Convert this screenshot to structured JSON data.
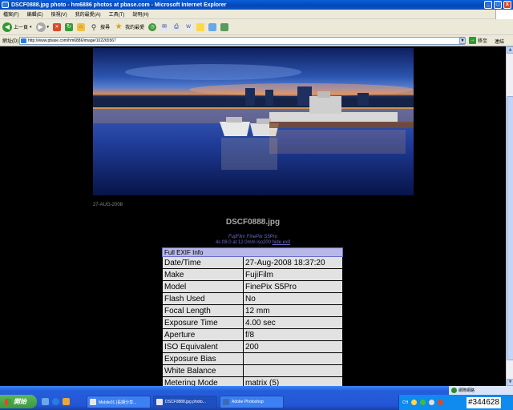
{
  "window": {
    "title": "DSCF0888.jpg photo - hm6886 photos at pbase.com - Microsoft Internet Explorer",
    "minimize": "_",
    "maximize": "□",
    "close": "x"
  },
  "menu": [
    "檔案(F)",
    "編輯(E)",
    "檢視(V)",
    "我的最愛(A)",
    "工具(T)",
    "說明(H)"
  ],
  "toolbar": {
    "back": "上一頁",
    "search": "搜尋",
    "favorites": "我的最愛"
  },
  "address": {
    "label": "網址(D)",
    "url": "http://www.pbase.com/hm6886/image/102265567",
    "go": "移至",
    "links": "連結"
  },
  "photo_page": {
    "date": "27-AUG-2008",
    "filename": "DSCF0888.jpg",
    "camera": "FujiFilm FinePix S5Pro",
    "settings": "4s f/8.0 at 12.0mm iso200",
    "hide_exif": "hide exif"
  },
  "exif": {
    "header": "Full EXIF Info",
    "rows": [
      [
        "Date/Time",
        "27-Aug-2008 18:37:20"
      ],
      [
        "Make",
        "FujiFilm"
      ],
      [
        "Model",
        "FinePix S5Pro"
      ],
      [
        "Flash Used",
        "No"
      ],
      [
        "Focal Length",
        "12 mm"
      ],
      [
        "Exposure Time",
        "4.00 sec"
      ],
      [
        "Aperture",
        "f/8"
      ],
      [
        "ISO Equivalent",
        "200"
      ],
      [
        "Exposure Bias",
        ""
      ],
      [
        "White Balance",
        ""
      ],
      [
        "Metering Mode",
        "matrix (5)"
      ]
    ]
  },
  "taskbar": {
    "start": "開始",
    "tasks": [
      "Mobile01 [長期分享...",
      "DSCF0888.jpg photo...",
      "Adobe Photoshop"
    ],
    "lang": "CH",
    "network_label": "網際網路",
    "clock": "#344628"
  }
}
